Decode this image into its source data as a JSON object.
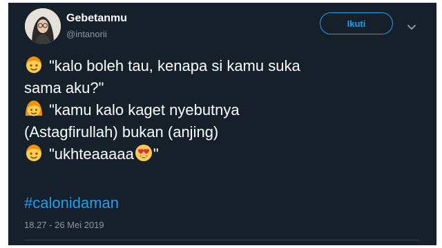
{
  "user": {
    "display_name": "Gebetanmu",
    "handle": "@intanorii"
  },
  "follow_button": {
    "label": "Ikuti"
  },
  "tweet": {
    "lines": [
      {
        "emoji": "boy-emoji",
        "text": "\"kalo boleh tau, kenapa si kamu suka"
      },
      {
        "emoji": "",
        "text": "sama aku?\""
      },
      {
        "emoji": "girl-emoji",
        "text": "\"kamu kalo kaget nyebutnya"
      },
      {
        "emoji": "",
        "text": "(Astagfirullah) bukan (anjing)"
      },
      {
        "emoji": "boy-emoji",
        "text": "\"ukhteaaaaa",
        "trailing_emoji": "heart-eyes-emoji",
        "trailing_text": "\""
      }
    ],
    "hashtag": "#calonidaman",
    "timestamp": "18.27 - 26 Mei 2019"
  },
  "colors": {
    "background": "#15202b",
    "accent": "#1da1f2",
    "secondary_text": "#8899a6"
  }
}
